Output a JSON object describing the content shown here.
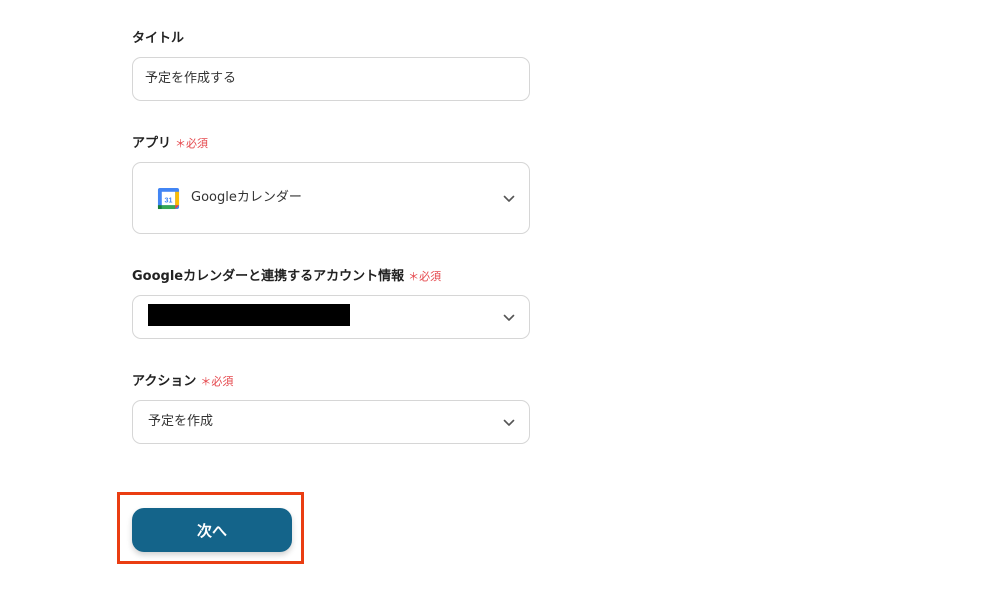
{
  "form": {
    "title_field": {
      "label": "タイトル",
      "value": "予定を作成する"
    },
    "app_field": {
      "label": "アプリ",
      "required_label": "必須",
      "value": "Googleカレンダー",
      "icon": "google-calendar-icon"
    },
    "account_field": {
      "label": "Googleカレンダーと連携するアカウント情報",
      "required_label": "必須"
    },
    "action_field": {
      "label": "アクション",
      "required_label": "必須",
      "value": "予定を作成"
    },
    "next_button": {
      "label": "次へ"
    }
  },
  "colors": {
    "required": "#e5484d",
    "button": "#14648a",
    "highlight": "#ea3d12",
    "border": "#d6d6d6"
  }
}
